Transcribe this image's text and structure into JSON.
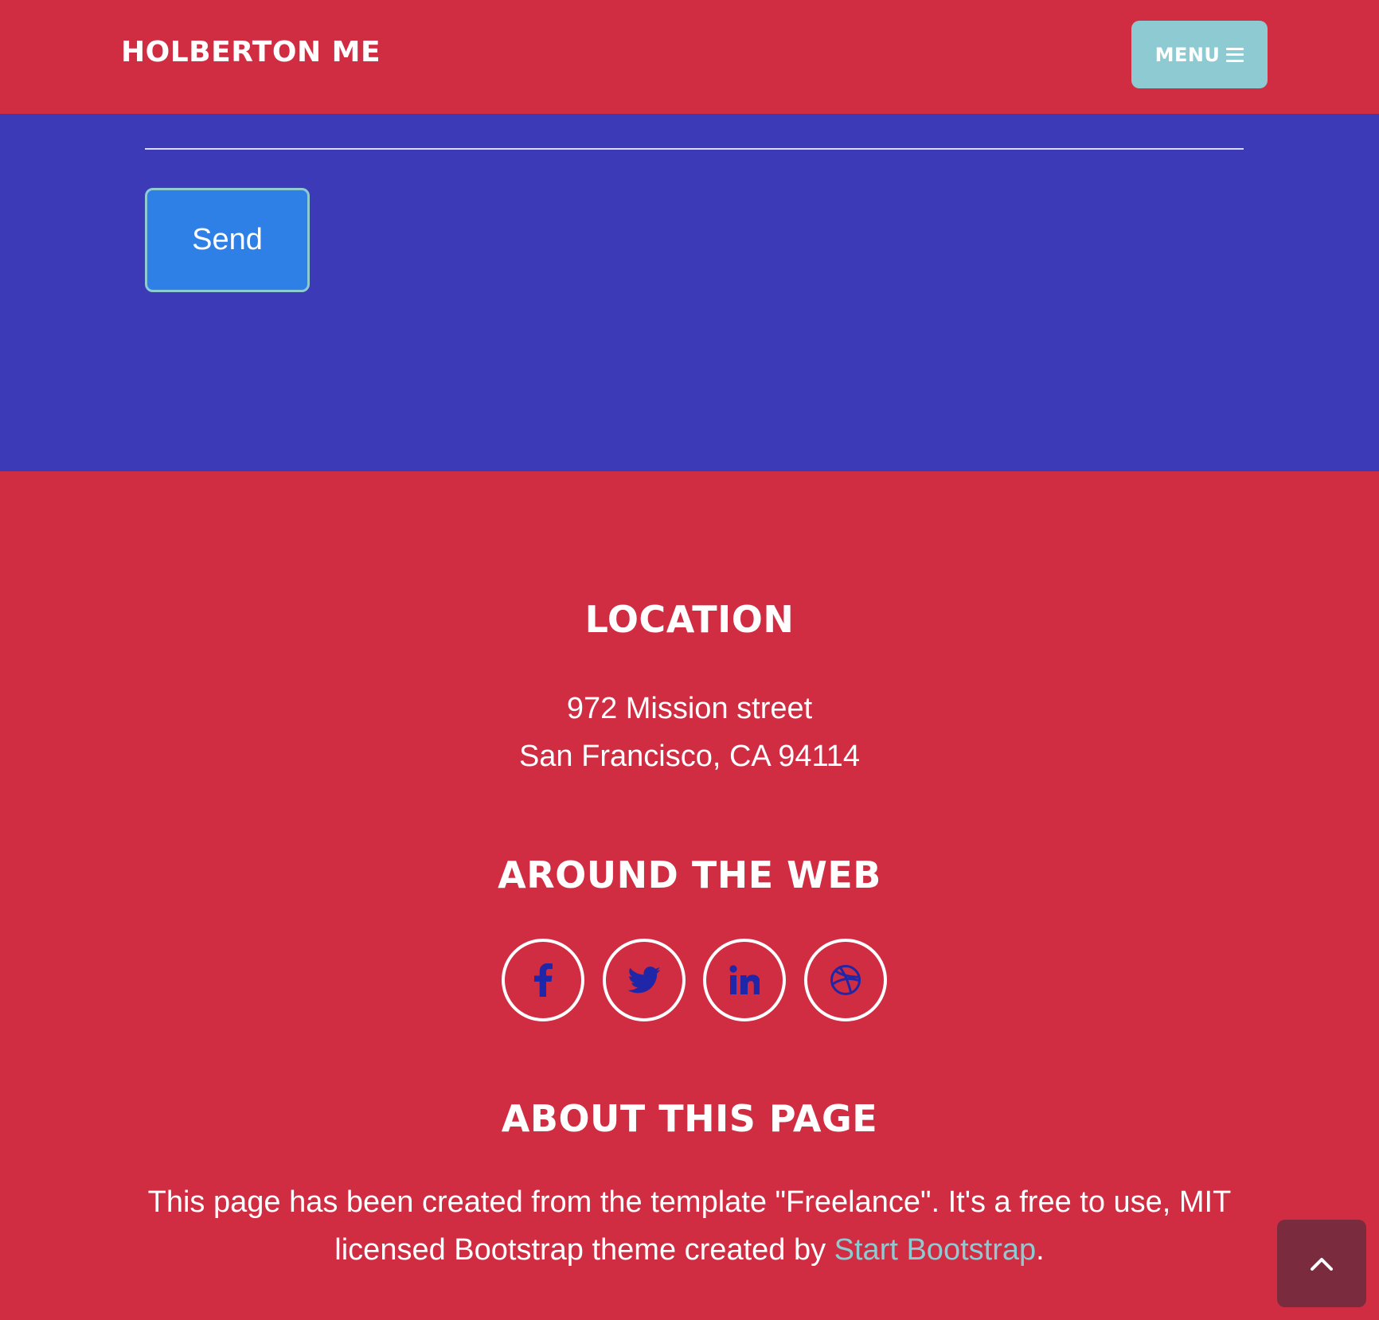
{
  "navbar": {
    "brand": "HOLBERTON ME",
    "menu_label": "MENU",
    "menu_icon": "bars-icon"
  },
  "contact": {
    "send_label": "Send"
  },
  "footer": {
    "location": {
      "title": "LOCATION",
      "line1": "972 Mission street",
      "line2": "San Francisco, CA 94114"
    },
    "web": {
      "title": "AROUND THE WEB",
      "links": [
        {
          "icon": "facebook-icon"
        },
        {
          "icon": "twitter-icon"
        },
        {
          "icon": "linkedin-icon"
        },
        {
          "icon": "dribbble-icon"
        }
      ]
    },
    "about": {
      "title": "ABOUT THIS PAGE",
      "text_before": "This page has been created from the template \"Freelance\". It's a free to use, MIT licensed Bootstrap theme created by ",
      "link_text": "Start Bootstrap",
      "text_after": "."
    }
  },
  "scroll_top": {
    "icon": "chevron-up-icon"
  },
  "colors": {
    "primary_red": "#d02c42",
    "contact_blue": "#3c3ab6",
    "accent_teal": "#8ecad2",
    "send_blue": "#2f80e6",
    "icon_blue": "#1f27a8",
    "scroll_top_bg": "#7a2b3e"
  }
}
